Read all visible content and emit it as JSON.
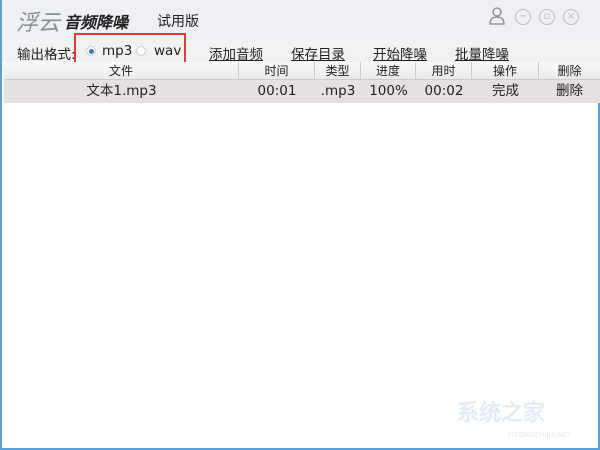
{
  "app": {
    "logo_main": "浮云",
    "logo_sub": "音频降噪",
    "edition": "试用版"
  },
  "window_buttons": {
    "user": "user-icon",
    "minimize": "minimize-icon",
    "restore": "restore-icon",
    "close": "close-icon"
  },
  "toolbar": {
    "format_label": "输出格式:",
    "formats": [
      {
        "label": "mp3",
        "selected": true
      },
      {
        "label": "wav",
        "selected": false
      }
    ],
    "actions": [
      "添加音频",
      "保存目录",
      "开始降噪",
      "批量降噪"
    ]
  },
  "table": {
    "headers": [
      "文件",
      "时间",
      "类型",
      "进度",
      "用时",
      "操作",
      "删除"
    ],
    "rows": [
      [
        "文本1.mp3",
        "00:01",
        ".mp3",
        "100%",
        "00:02",
        "完成",
        "删除"
      ]
    ]
  },
  "watermark": {
    "text": "系统之家",
    "sub": "XITONGZHIJIA.NET"
  },
  "colors": {
    "highlight": "#e03a3a",
    "border": "#5aa0d8"
  }
}
